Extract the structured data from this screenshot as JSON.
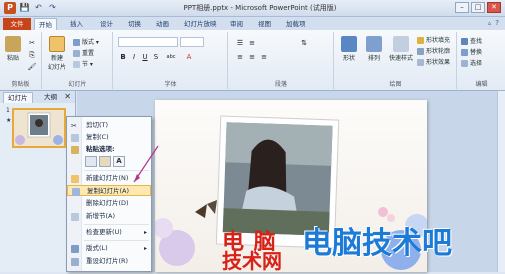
{
  "window": {
    "title": "PPT相册.pptx - Microsoft PowerPoint (试用版)",
    "logo": "P",
    "controls": {
      "minimize": "–",
      "maximize": "□",
      "close": "✕"
    }
  },
  "qat": {
    "save": "💾",
    "undo": "↶",
    "redo": "↷"
  },
  "tabs": [
    {
      "label": "文件"
    },
    {
      "label": "开始"
    },
    {
      "label": "插入"
    },
    {
      "label": "设计"
    },
    {
      "label": "切换"
    },
    {
      "label": "动画"
    },
    {
      "label": "幻灯片放映"
    },
    {
      "label": "审阅"
    },
    {
      "label": "视图"
    },
    {
      "label": "加载项"
    }
  ],
  "ribbon": {
    "clipboard": {
      "paste": "粘贴",
      "label": "剪贴板"
    },
    "slides": {
      "new_slide": "新建\n幻灯片",
      "layout": "版式",
      "reset": "重置",
      "section": "节",
      "label": "幻灯片"
    },
    "font": {
      "label": "字体",
      "bold": "B",
      "italic": "I",
      "underline": "U",
      "strike": "S",
      "shadow": "abc",
      "fontcolor": "A"
    },
    "paragraph": {
      "label": "段落"
    },
    "drawing": {
      "shapes": "形状",
      "arrange": "排列",
      "quick_styles": "快速样式",
      "fill": "形状填充",
      "outline": "形状轮廓",
      "effects": "形状效果",
      "label": "绘图"
    },
    "editing": {
      "find": "查找",
      "replace": "替换",
      "select": "选择",
      "label": "编辑"
    }
  },
  "pane": {
    "tab_slides": "幻灯片",
    "tab_outline": "大纲",
    "close": "✕",
    "slide_number": "1",
    "slide_star": "★"
  },
  "context_menu": {
    "cut": "剪切(T)",
    "copy": "复制(C)",
    "paste_options": "粘贴选项:",
    "paste_opt_a": "A",
    "new_slide": "新建幻灯片(N)",
    "duplicate_slide": "复制幻灯片(A)",
    "delete_slide": "删除幻灯片(D)",
    "new_section": "新增节(A)",
    "publish_slides": "检查更新(U)",
    "layout": "版式(L)",
    "reset_slide": "重设幻灯片(R)"
  },
  "watermark": {
    "line1": "电 脑",
    "line2": "技术网",
    "line3": "电脑技术吧"
  }
}
